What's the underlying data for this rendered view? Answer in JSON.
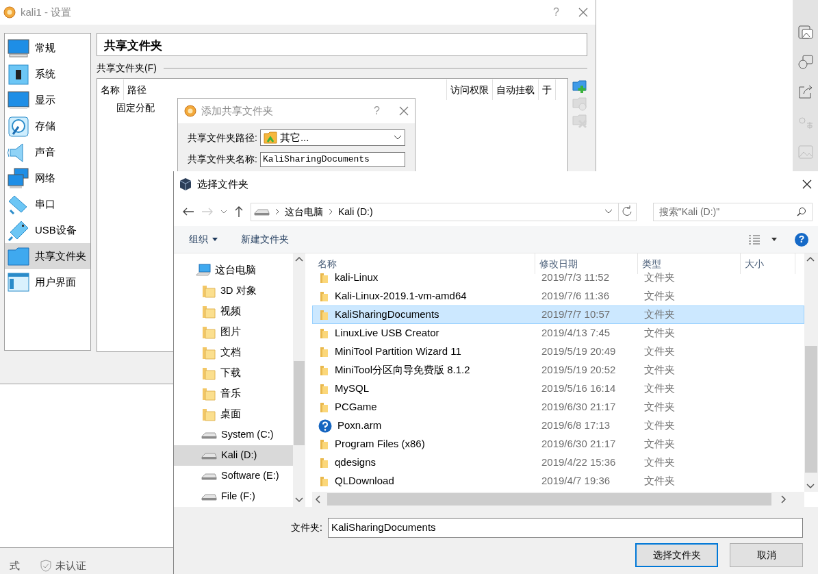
{
  "settings_window": {
    "title": "kali1 - 设置",
    "help": "?",
    "nav": [
      {
        "label": "常规",
        "kind": "general",
        "selected": false
      },
      {
        "label": "系统",
        "kind": "system",
        "selected": false
      },
      {
        "label": "显示",
        "kind": "display",
        "selected": false
      },
      {
        "label": "存储",
        "kind": "storage",
        "selected": false
      },
      {
        "label": "声音",
        "kind": "audio",
        "selected": false
      },
      {
        "label": "网络",
        "kind": "network",
        "selected": false
      },
      {
        "label": "串口",
        "kind": "serial",
        "selected": false
      },
      {
        "label": "USB设备",
        "kind": "usb",
        "selected": false
      },
      {
        "label": "共享文件夹",
        "kind": "shared",
        "selected": true
      },
      {
        "label": "用户界面",
        "kind": "ui",
        "selected": false
      }
    ],
    "page_title": "共享文件夹",
    "section_label": "共享文件夹(F)",
    "table": {
      "columns": [
        "名称",
        "路径",
        "访问权限",
        "自动挂载",
        "于"
      ],
      "group": "固定分配"
    },
    "tools": [
      {
        "kind": "add",
        "disabled": false
      },
      {
        "kind": "edit",
        "disabled": true
      },
      {
        "kind": "remove",
        "disabled": true
      }
    ],
    "status_bar": [
      "式",
      "未认证"
    ]
  },
  "add_dialog": {
    "title": "添加共享文件夹",
    "help": "?",
    "path_label": "共享文件夹路径:",
    "path_value": "其它...",
    "name_label": "共享文件夹名称:",
    "name_value": "KaliSharingDocuments"
  },
  "folder_dialog": {
    "title": "选择文件夹",
    "breadcrumb": [
      "这台电脑",
      "Kali (D:)"
    ],
    "search": {
      "placeholder": "搜索\"Kali (D:)\""
    },
    "toolbar": {
      "organize": "组织",
      "new_folder": "新建文件夹",
      "help": "?"
    },
    "tree": [
      {
        "label": "这台电脑",
        "kind": "computer",
        "selected": false,
        "children": [
          {
            "label": "3D 对象",
            "kind": "folder",
            "selected": false
          },
          {
            "label": "视频",
            "kind": "folder",
            "selected": false
          },
          {
            "label": "图片",
            "kind": "folder",
            "selected": false
          },
          {
            "label": "文档",
            "kind": "folder",
            "selected": false
          },
          {
            "label": "下载",
            "kind": "folder",
            "selected": false
          },
          {
            "label": "音乐",
            "kind": "folder",
            "selected": false
          },
          {
            "label": "桌面",
            "kind": "folder",
            "selected": false
          },
          {
            "label": "System (C:)",
            "kind": "drive",
            "selected": false
          },
          {
            "label": "Kali (D:)",
            "kind": "drive",
            "selected": true
          },
          {
            "label": "Software (E:)",
            "kind": "drive",
            "selected": false
          },
          {
            "label": "File (F:)",
            "kind": "drive",
            "selected": false
          }
        ]
      }
    ],
    "columns": [
      "名称",
      "修改日期",
      "类型",
      "大小"
    ],
    "files": [
      {
        "name": "kali-Linux",
        "date": "2019/7/3 11:52",
        "type": "文件夹",
        "kind": "folder",
        "selected": false
      },
      {
        "name": "Kali-Linux-2019.1-vm-amd64",
        "date": "2019/7/6 11:36",
        "type": "文件夹",
        "kind": "folder",
        "selected": false
      },
      {
        "name": "KaliSharingDocuments",
        "date": "2019/7/7 10:57",
        "type": "文件夹",
        "kind": "folder",
        "selected": true
      },
      {
        "name": "LinuxLive USB Creator",
        "date": "2019/4/13 7:45",
        "type": "文件夹",
        "kind": "folder",
        "selected": false
      },
      {
        "name": "MiniTool Partition Wizard 11",
        "date": "2019/5/19 20:49",
        "type": "文件夹",
        "kind": "folder",
        "selected": false
      },
      {
        "name": "MiniTool分区向导免费版 8.1.2",
        "date": "2019/5/19 20:52",
        "type": "文件夹",
        "kind": "folder",
        "selected": false
      },
      {
        "name": "MySQL",
        "date": "2019/5/16 16:14",
        "type": "文件夹",
        "kind": "folder",
        "selected": false
      },
      {
        "name": "PCGame",
        "date": "2019/6/30 21:17",
        "type": "文件夹",
        "kind": "folder",
        "selected": false
      },
      {
        "name": "Poxn.arm",
        "date": "2019/6/8 17:13",
        "type": "文件夹",
        "kind": "unknown",
        "selected": false
      },
      {
        "name": "Program Files (x86)",
        "date": "2019/6/30 21:17",
        "type": "文件夹",
        "kind": "folder",
        "selected": false
      },
      {
        "name": "qdesigns",
        "date": "2019/4/22 15:36",
        "type": "文件夹",
        "kind": "folder",
        "selected": false
      },
      {
        "name": "QLDownload",
        "date": "2019/4/7 19:36",
        "type": "文件夹",
        "kind": "folder",
        "selected": false
      }
    ],
    "folder_label": "文件夹:",
    "folder_value": "KaliSharingDocuments",
    "buttons": [
      {
        "label": "选择文件夹",
        "kind": "primary"
      },
      {
        "label": "取消",
        "kind": "secondary"
      }
    ]
  }
}
